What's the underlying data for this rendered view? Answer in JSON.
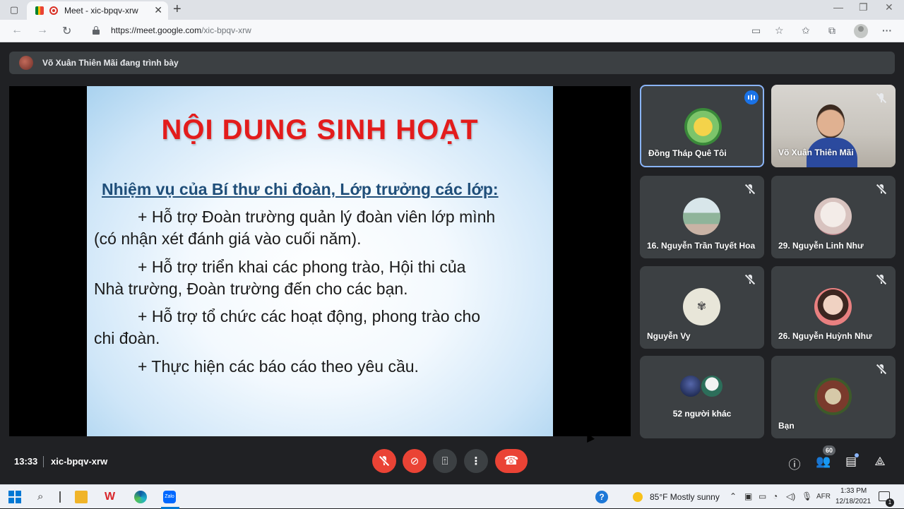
{
  "browser": {
    "tab_title": "Meet - xic-bpqv-xrw",
    "url_host": "https://meet.google.com",
    "url_path": "/xic-bpqv-xrw"
  },
  "banner": {
    "presenter_text": "Võ Xuân Thiên Mãi đang trình bày"
  },
  "slide": {
    "title": "NỘI DUNG SINH HOẠT",
    "subtitle": "Nhiệm vụ của Bí thư chi đoàn, Lớp trưởng các lớp:",
    "lines": [
      "+ Hỗ trợ Đoàn trường quản lý đoàn viên lớp mình",
      "(có nhận xét đánh giá vào cuối năm).",
      "+ Hỗ trợ triển khai các phong trào, Hội thi của",
      "Nhà trường, Đoàn trường đến cho các bạn.",
      "+ Hỗ trợ tổ chức các hoạt động, phong trào cho",
      "chi đoàn.",
      "+ Thực hiện các báo cáo theo yêu cầu."
    ]
  },
  "participants": [
    {
      "name": "Đồng Tháp Quê Tôi",
      "state": "speaking"
    },
    {
      "name": "Võ Xuân Thiên Mãi",
      "state": "muted"
    },
    {
      "name": "16. Nguyễn Trần Tuyết Hoa",
      "state": "muted"
    },
    {
      "name": "29. Nguyễn Linh Như",
      "state": "muted"
    },
    {
      "name": "Nguyễn Vy",
      "state": "muted"
    },
    {
      "name": "26. Nguyễn Huỳnh Như",
      "state": "muted"
    },
    {
      "name": "52 người khác",
      "state": "group"
    },
    {
      "name": "Bạn",
      "state": "muted"
    }
  ],
  "bottom_bar": {
    "time": "13:33",
    "meeting_code": "xic-bpqv-xrw",
    "people_count": "60"
  },
  "taskbar": {
    "weather": "85°F  Mostly sunny",
    "language": "AFR",
    "time": "1:33 PM",
    "date": "12/18/2021",
    "notifications": "1"
  },
  "colors": {
    "meet_bg": "#202124",
    "tile_bg": "#3c4043",
    "danger": "#ea4335",
    "active_border": "#8ab4f8",
    "slide_title": "#e31c1c",
    "slide_subtitle": "#1f4e79"
  }
}
